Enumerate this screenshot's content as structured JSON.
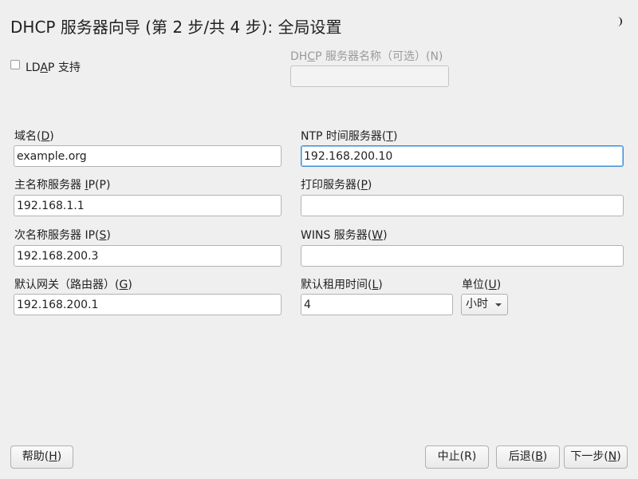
{
  "header": {
    "title": "DHCP 服务器向导 (第 2 步/共 4 步): 全局设置"
  },
  "ldap": {
    "checked": false,
    "label_pre": "LD",
    "label_key": "A",
    "label_post": "P 支持"
  },
  "server_name": {
    "label_pre": "DH",
    "label_key": "C",
    "label_post": "P 服务器名称（可选）(N)",
    "value": "",
    "enabled": false
  },
  "domain": {
    "label_pre": "域名(",
    "label_key": "D",
    "label_post": ")",
    "value": "example.org"
  },
  "primary_ns": {
    "label_pre": "主名称服务器 ",
    "label_key": "I",
    "label_post": "P(P)",
    "value": "192.168.1.1"
  },
  "secondary_ns": {
    "label_pre": "次名称服务器 IP(",
    "label_key": "S",
    "label_post": ")",
    "value": "192.168.200.3"
  },
  "gateway": {
    "label_pre": "默认网关（路由器）(",
    "label_key": "G",
    "label_post": ")",
    "value": "192.168.200.1"
  },
  "ntp": {
    "label_pre": "NTP 时间服务器(",
    "label_key": "T",
    "label_post": ")",
    "value": "192.168.200.10"
  },
  "print_server": {
    "label_pre": "打印服务器(",
    "label_key": "P",
    "label_post": ")",
    "value": ""
  },
  "wins": {
    "label_pre": "WINS 服务器(",
    "label_key": "W",
    "label_post": ")",
    "value": ""
  },
  "lease": {
    "label_pre": "默认租用时间(",
    "label_key": "L",
    "label_post": ")",
    "value": "4"
  },
  "unit": {
    "label_pre": "单位(",
    "label_key": "U",
    "label_post": ")",
    "selected": "小时"
  },
  "buttons": {
    "help_pre": "帮助(",
    "help_key": "H",
    "help_post": ")",
    "abort_label": "中止(R)",
    "back_pre": "后退(",
    "back_key": "B",
    "back_post": ")",
    "next_pre": "下一步(",
    "next_key": "N",
    "next_post": ")"
  },
  "colors": {
    "background": "#efefef",
    "focus_border": "#3d8ed8",
    "disabled_text": "#9a9a9a"
  },
  "icons": {
    "theme_toggle": "crescent-moon-icon"
  }
}
